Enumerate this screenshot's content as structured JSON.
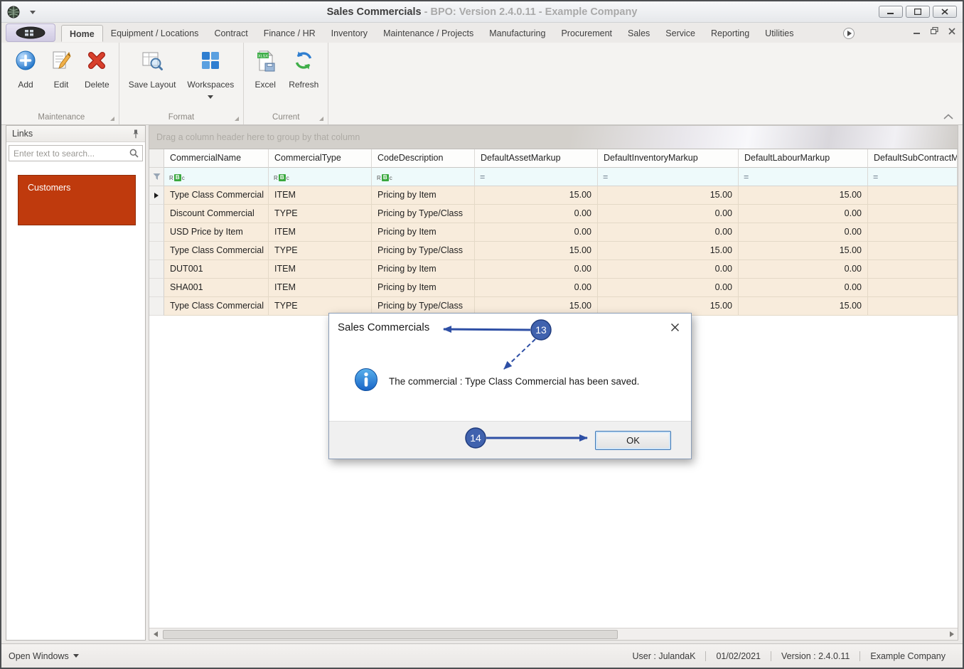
{
  "window": {
    "title_main": "Sales Commercials",
    "title_rest": " - BPO: Version 2.4.0.11 - Example Company"
  },
  "ribbon": {
    "tabs": [
      {
        "label": "Home",
        "active": true
      },
      {
        "label": "Equipment / Locations"
      },
      {
        "label": "Contract"
      },
      {
        "label": "Finance / HR"
      },
      {
        "label": "Inventory"
      },
      {
        "label": "Maintenance / Projects"
      },
      {
        "label": "Manufacturing"
      },
      {
        "label": "Procurement"
      },
      {
        "label": "Sales"
      },
      {
        "label": "Service"
      },
      {
        "label": "Reporting"
      },
      {
        "label": "Utilities"
      }
    ],
    "groups": {
      "maintenance": {
        "label": "Maintenance",
        "add": "Add",
        "edit": "Edit",
        "delete": "Delete"
      },
      "format": {
        "label": "Format",
        "save_layout": "Save Layout",
        "workspaces": "Workspaces"
      },
      "current": {
        "label": "Current",
        "excel": "Excel",
        "refresh": "Refresh",
        "excel_badge": "XLSX"
      }
    }
  },
  "sidebar": {
    "title": "Links",
    "search_placeholder": "Enter text to search...",
    "tiles": [
      {
        "label": "Customers",
        "color": "#bf3a0d"
      }
    ]
  },
  "grid": {
    "group_hint": "Drag a column header here to group by that column",
    "columns": [
      "CommercialName",
      "CommercialType",
      "CodeDescription",
      "DefaultAssetMarkup",
      "DefaultInventoryMarkup",
      "DefaultLabourMarkup",
      "DefaultSubContractM"
    ],
    "filter_numeric_glyph": "=",
    "filter_text_glyph": "RBc",
    "rows": [
      {
        "name": "Type Class Commercial",
        "type": "ITEM",
        "desc": "Pricing by Item",
        "asset": "15.00",
        "inventory": "15.00",
        "labour": "15.00"
      },
      {
        "name": "Discount Commercial",
        "type": "TYPE",
        "desc": "Pricing by Type/Class",
        "asset": "0.00",
        "inventory": "0.00",
        "labour": "0.00"
      },
      {
        "name": "USD Price by Item",
        "type": "ITEM",
        "desc": "Pricing by Item",
        "asset": "0.00",
        "inventory": "0.00",
        "labour": "0.00"
      },
      {
        "name": "Type Class Commercial",
        "type": "TYPE",
        "desc": "Pricing by Type/Class",
        "asset": "15.00",
        "inventory": "15.00",
        "labour": "15.00"
      },
      {
        "name": "DUT001",
        "type": "ITEM",
        "desc": "Pricing by Item",
        "asset": "0.00",
        "inventory": "0.00",
        "labour": "0.00"
      },
      {
        "name": "SHA001",
        "type": "ITEM",
        "desc": "Pricing by Item",
        "asset": "0.00",
        "inventory": "0.00",
        "labour": "0.00"
      },
      {
        "name": "Type Class Commercial",
        "type": "TYPE",
        "desc": "Pricing by Type/Class",
        "asset": "15.00",
        "inventory": "15.00",
        "labour": "15.00"
      }
    ]
  },
  "dialog": {
    "title": "Sales Commercials",
    "message": "The commercial : Type Class Commercial has been saved.",
    "ok_label": "OK"
  },
  "annotations": {
    "step13": "13",
    "step14": "14",
    "arrow_color": "#2e4fa5"
  },
  "statusbar": {
    "open_windows": "Open Windows",
    "user": "User : JulandaK",
    "date": "01/02/2021",
    "version": "Version : 2.4.0.11",
    "company": "Example Company"
  }
}
